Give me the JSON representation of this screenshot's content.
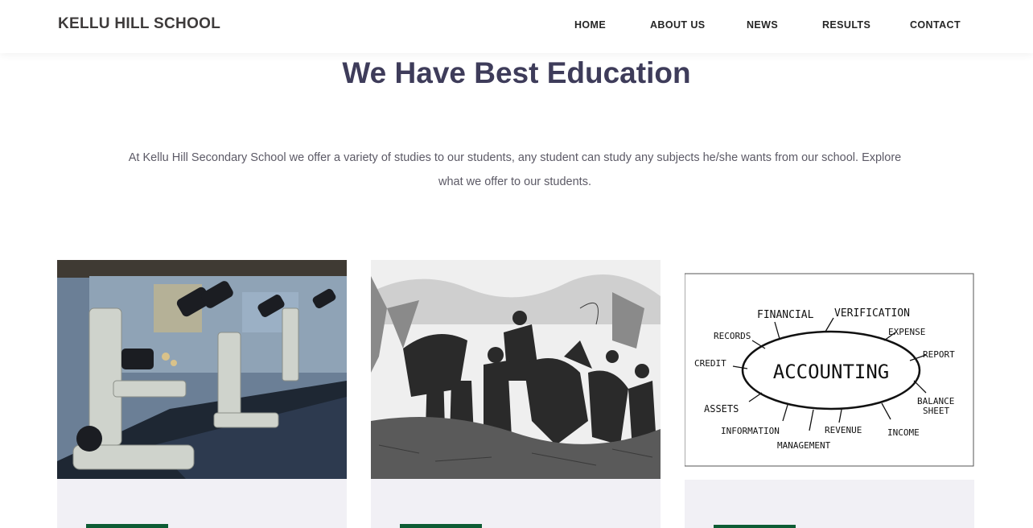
{
  "header": {
    "brand": "KELLU HILL SCHOOL",
    "nav": [
      {
        "label": "HOME"
      },
      {
        "label": "ABOUT US"
      },
      {
        "label": "NEWS"
      },
      {
        "label": "RESULTS"
      },
      {
        "label": "CONTACT"
      }
    ]
  },
  "section": {
    "title": "We Have Best Education",
    "intro": "At Kellu Hill Secondary School we offer a variety of studies to our students, any student can study any subjects he/she wants from our school. Explore what we offer to our students."
  },
  "cards": [
    {
      "image": "microscopes-lab-photo"
    },
    {
      "image": "historical-etching-illustration"
    },
    {
      "image": "accounting-mind-map",
      "diagram_center": "ACCOUNTING",
      "diagram_terms": [
        "FINANCIAL",
        "VERIFICATION",
        "RECORDS",
        "EXPENSE",
        "REPORT",
        "CREDIT",
        "ASSETS",
        "BALANCE",
        "SHEET",
        "INFORMATION",
        "REVENUE",
        "INCOME",
        "MANAGEMENT"
      ]
    }
  ],
  "colors": {
    "accent_green": "#0d5c34",
    "title": "#3e3c5a",
    "card_bg": "#f1f0f5"
  }
}
